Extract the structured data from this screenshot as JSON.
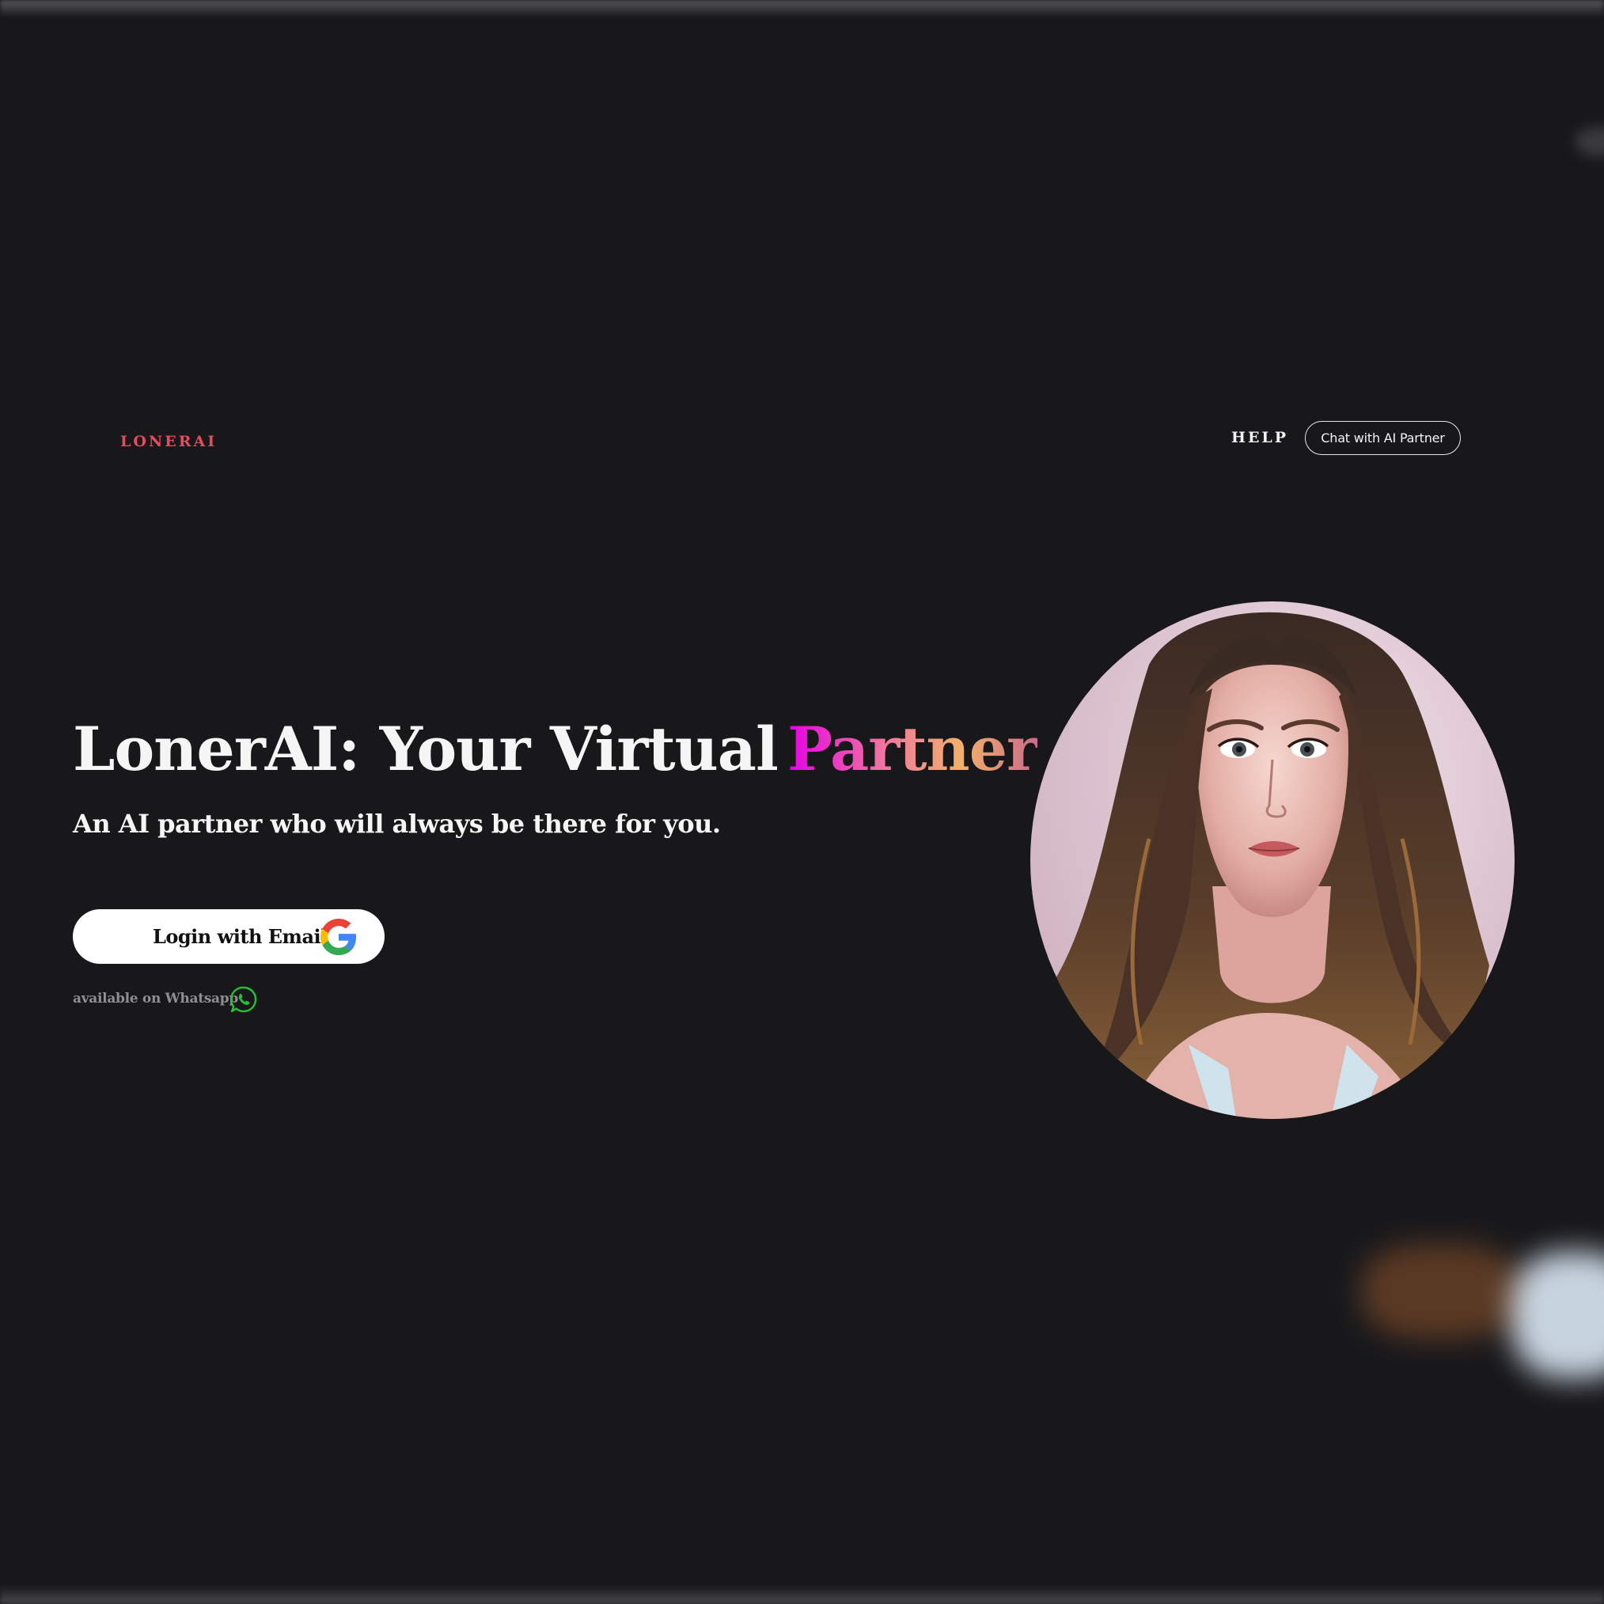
{
  "header": {
    "logo": "LONERAI",
    "nav": {
      "help": "HELP",
      "chat_button": "Chat with AI Partner"
    }
  },
  "hero": {
    "title_main": "LonerAI: Your Virtual",
    "title_accent": "Partner",
    "subtitle": "An AI partner who will always be there for you.",
    "login_button": "Login with Email",
    "whatsapp_text": "available on Whatsapp"
  },
  "icons": {
    "login": "google-icon",
    "whatsapp": "whatsapp-icon"
  },
  "colors": {
    "background": "#18181b",
    "logo": "#e84a5f",
    "accent_gradient": [
      "#e600e6",
      "#f07a9c",
      "#f2b06a",
      "#c96b8c"
    ],
    "whatsapp": "#25c03a"
  }
}
